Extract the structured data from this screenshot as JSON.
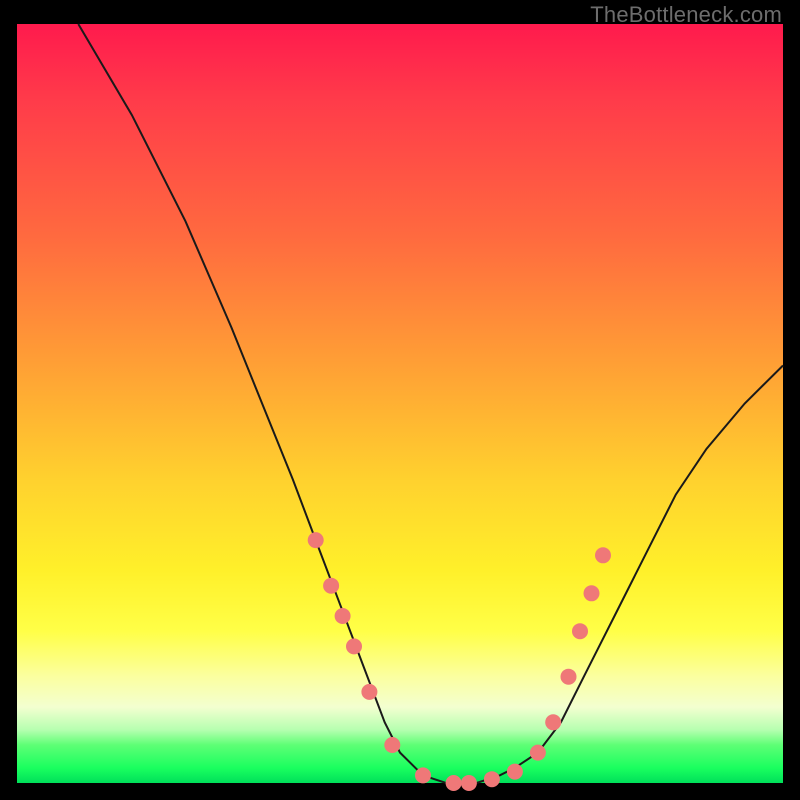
{
  "watermark": "TheBottleneck.com",
  "colors": {
    "background": "#000000",
    "curve": "#1a1a1a",
    "dot": "#ef7878",
    "gradient_top": "#ff1a4d",
    "gradient_mid": "#ffd12e",
    "gradient_bottom": "#00e05a"
  },
  "chart_data": {
    "type": "line",
    "title": "",
    "xlabel": "",
    "ylabel": "",
    "xlim": [
      0,
      100
    ],
    "ylim": [
      0,
      100
    ],
    "grid": false,
    "legend": false,
    "series": [
      {
        "name": "bottleneck-curve",
        "x": [
          8,
          15,
          22,
          28,
          32,
          36,
          39,
          42,
          45,
          48,
          50,
          53,
          56,
          60,
          63,
          65,
          68,
          71,
          74,
          78,
          82,
          86,
          90,
          95,
          100
        ],
        "y": [
          100,
          88,
          74,
          60,
          50,
          40,
          32,
          24,
          16,
          8,
          4,
          1,
          0,
          0,
          1,
          2,
          4,
          8,
          14,
          22,
          30,
          38,
          44,
          50,
          55
        ]
      }
    ],
    "highlight_dots": {
      "name": "threshold-markers",
      "points": [
        {
          "x": 39,
          "y": 32
        },
        {
          "x": 41,
          "y": 26
        },
        {
          "x": 42.5,
          "y": 22
        },
        {
          "x": 44,
          "y": 18
        },
        {
          "x": 46,
          "y": 12
        },
        {
          "x": 49,
          "y": 5
        },
        {
          "x": 53,
          "y": 1
        },
        {
          "x": 57,
          "y": 0
        },
        {
          "x": 59,
          "y": 0
        },
        {
          "x": 62,
          "y": 0.5
        },
        {
          "x": 65,
          "y": 1.5
        },
        {
          "x": 68,
          "y": 4
        },
        {
          "x": 70,
          "y": 8
        },
        {
          "x": 72,
          "y": 14
        },
        {
          "x": 73.5,
          "y": 20
        },
        {
          "x": 75,
          "y": 25
        },
        {
          "x": 76.5,
          "y": 30
        }
      ]
    }
  }
}
